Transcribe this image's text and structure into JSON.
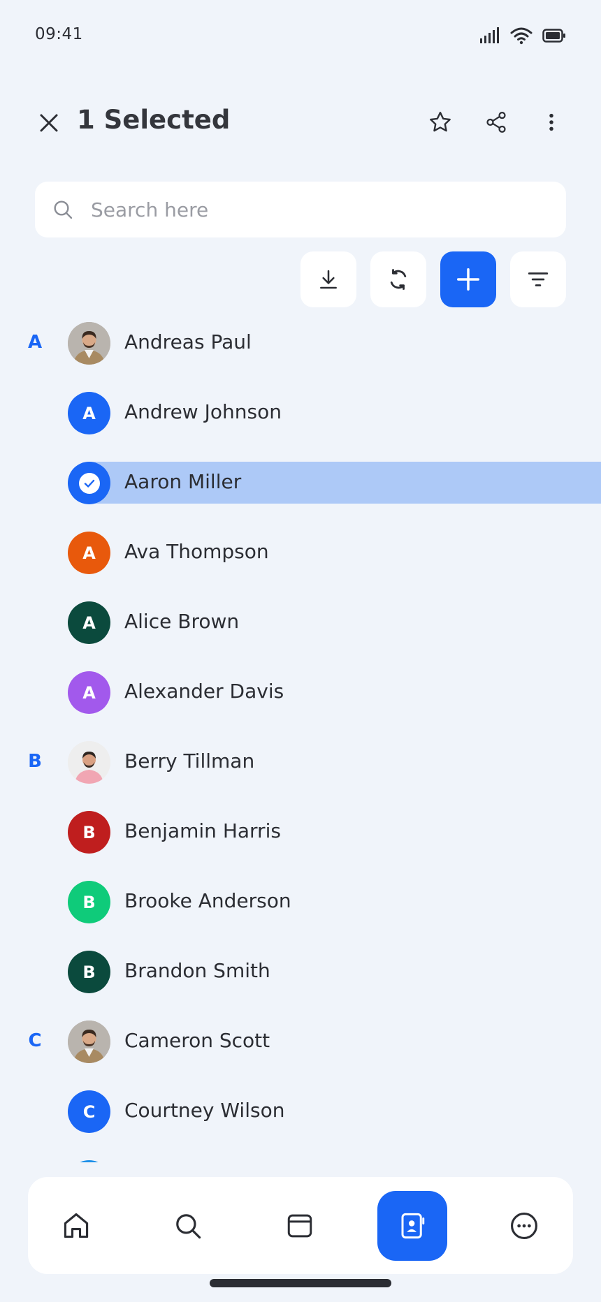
{
  "status_bar": {
    "time": "09:41",
    "icons": [
      "signal-icon",
      "wifi-icon",
      "battery-icon"
    ]
  },
  "header": {
    "title": "1 Selected",
    "actions": [
      "star-icon",
      "share-icon",
      "more-vertical-icon"
    ]
  },
  "search": {
    "placeholder": "Search here",
    "value": ""
  },
  "toolbar": {
    "buttons": [
      "download-icon",
      "sync-icon",
      "add-icon",
      "filter-icon"
    ]
  },
  "colors": {
    "accent": "#1a66f5",
    "background": "#f0f4fa",
    "selected_row": "#adc9f7",
    "text": "#2b2d33"
  },
  "contacts": [
    {
      "section": "A",
      "name": "Andreas Paul",
      "avatar_type": "photo-man-beard",
      "initial": "",
      "color": "#b8b3ad",
      "selected": false
    },
    {
      "section": "",
      "name": "Andrew Johnson",
      "avatar_type": "initial",
      "initial": "A",
      "color": "#1a66f5",
      "selected": false
    },
    {
      "section": "",
      "name": "Aaron Miller",
      "avatar_type": "check",
      "initial": "",
      "color": "#1a66f5",
      "selected": true
    },
    {
      "section": "",
      "name": "Ava Thompson",
      "avatar_type": "initial",
      "initial": "A",
      "color": "#e8590c",
      "selected": false
    },
    {
      "section": "",
      "name": "Alice Brown",
      "avatar_type": "initial",
      "initial": "A",
      "color": "#0b4a3d",
      "selected": false
    },
    {
      "section": "",
      "name": "Alexander Davis",
      "avatar_type": "initial",
      "initial": "A",
      "color": "#a259ec",
      "selected": false
    },
    {
      "section": "B",
      "name": "Berry Tillman",
      "avatar_type": "photo-man-pink",
      "initial": "",
      "color": "#eeeeee",
      "selected": false
    },
    {
      "section": "",
      "name": "Benjamin Harris",
      "avatar_type": "initial",
      "initial": "B",
      "color": "#bf1e1e",
      "selected": false
    },
    {
      "section": "",
      "name": "Brooke Anderson",
      "avatar_type": "initial",
      "initial": "B",
      "color": "#0fcb7a",
      "selected": false
    },
    {
      "section": "",
      "name": "Brandon Smith",
      "avatar_type": "initial",
      "initial": "B",
      "color": "#0b4a3d",
      "selected": false
    },
    {
      "section": "C",
      "name": "Cameron Scott",
      "avatar_type": "photo-man-beard",
      "initial": "",
      "color": "#b8b3ad",
      "selected": false
    },
    {
      "section": "",
      "name": "Courtney Wilson",
      "avatar_type": "initial",
      "initial": "C",
      "color": "#1a66f5",
      "selected": false
    },
    {
      "section": "",
      "name": "",
      "avatar_type": "initial",
      "initial": "",
      "color": "#1c8fe8",
      "selected": false
    }
  ],
  "bottom_nav": {
    "items": [
      {
        "icon": "home-icon",
        "active": false
      },
      {
        "icon": "search-icon",
        "active": false
      },
      {
        "icon": "window-icon",
        "active": false
      },
      {
        "icon": "contacts-icon",
        "active": true
      },
      {
        "icon": "more-horizontal-icon",
        "active": false
      }
    ]
  }
}
